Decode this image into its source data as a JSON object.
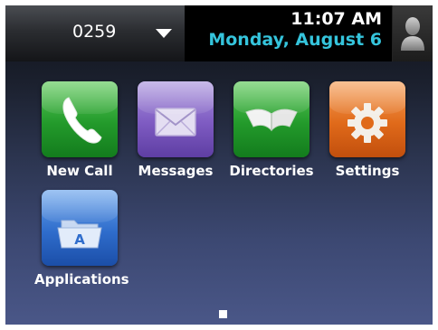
{
  "status_bar": {
    "line_label": "0259",
    "time": "11:07 AM",
    "date": "Monday, August 6"
  },
  "apps": [
    {
      "label": "New Call",
      "icon": "phone-handset-icon",
      "color": "#239a2b"
    },
    {
      "label": "Messages",
      "icon": "envelope-icon",
      "color": "#7e5bc2"
    },
    {
      "label": "Directories",
      "icon": "open-book-icon",
      "color": "#239a2b"
    },
    {
      "label": "Settings",
      "icon": "gear-icon",
      "color": "#e06a1a"
    },
    {
      "label": "Applications",
      "icon": "folder-icon",
      "color": "#2f6dcc"
    }
  ],
  "date_color": "#35c4dc",
  "page_indicator": {
    "current": 1,
    "total": 1
  }
}
